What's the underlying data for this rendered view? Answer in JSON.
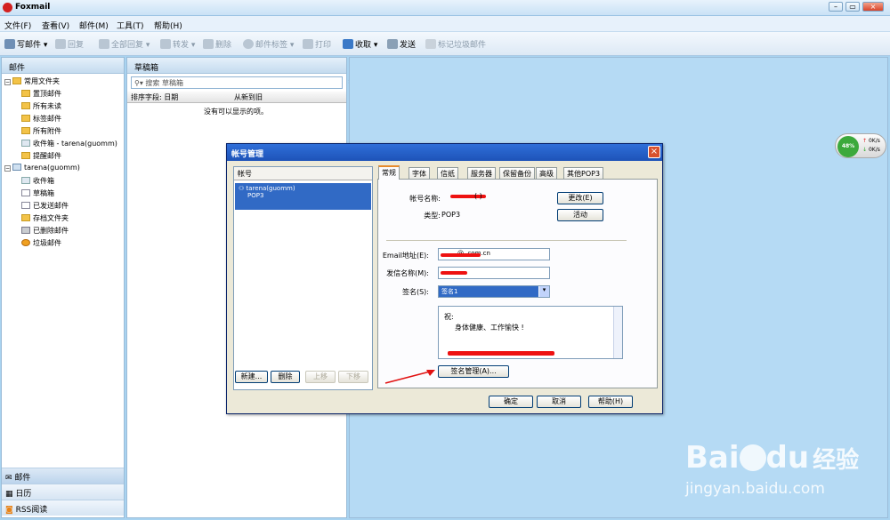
{
  "app": {
    "title": "Foxmail"
  },
  "menu": [
    "文件(F)",
    "查看(V)",
    "邮件(M)",
    "工具(T)",
    "帮助(H)"
  ],
  "toolbar": {
    "write": "写邮件",
    "reply": "回复",
    "reply_all": "全部回复",
    "forward": "转发",
    "delete": "删除",
    "tag": "邮件标签",
    "print": "打印",
    "receive": "收取",
    "send": "发送",
    "spam": "标记垃圾邮件"
  },
  "left": {
    "header": "邮件",
    "common": "常用文件夹",
    "common_items": [
      "置顶邮件",
      "所有未读",
      "标签邮件",
      "所有附件",
      "收件箱 - tarena(guomm)",
      "提醒邮件"
    ],
    "account": "tarena(guomm)",
    "account_items": [
      "收件箱",
      "草稿箱",
      "已发送邮件",
      "存档文件夹",
      "已删除邮件",
      "垃圾邮件"
    ],
    "nav": [
      "邮件",
      "日历",
      "RSS阅读"
    ]
  },
  "mid": {
    "header": "草稿箱",
    "search_placeholder": "搜索 草稿箱",
    "sort_label": "排序字段: 日期",
    "order": "从新到旧",
    "empty": "没有可以显示的项。"
  },
  "netwidget": {
    "percent": "48%",
    "up": "0K/s",
    "down": "0K/s"
  },
  "dialog": {
    "title": "帐号管理",
    "list_header": "帐号",
    "account_name": "tarena(guomm)",
    "account_type": "POP3",
    "btn_new": "新建...",
    "btn_delete": "删除",
    "btn_up": "上移",
    "btn_down": "下移",
    "tabs": [
      "常规",
      "字体",
      "信纸",
      "服务器",
      "保留备份",
      "高级",
      "其他POP3"
    ],
    "name_label": "帐号名称:",
    "name_value": "(       )",
    "btn_change": "更改(E)",
    "type_label": "类型:",
    "type_value": "POP3",
    "btn_active": "活动",
    "email_label": "Email地址(E):",
    "email_value": "@         .com.cn",
    "sender_label": "发信名称(M):",
    "sig_label": "签名(S):",
    "sig_value": "签名1",
    "sig_line1": "祝:",
    "sig_line2": "身体健康、工作愉快 !",
    "btn_sig": "签名管理(A)...",
    "btn_ok": "确定",
    "btn_cancel": "取消",
    "btn_help": "帮助(H)"
  },
  "watermark": {
    "brand": "Bai",
    "brand2": "du",
    "cn": "经验",
    "url": "jingyan.baidu.com"
  },
  "colors": {
    "accent": "#1e53b8",
    "redact": "#e11111"
  }
}
